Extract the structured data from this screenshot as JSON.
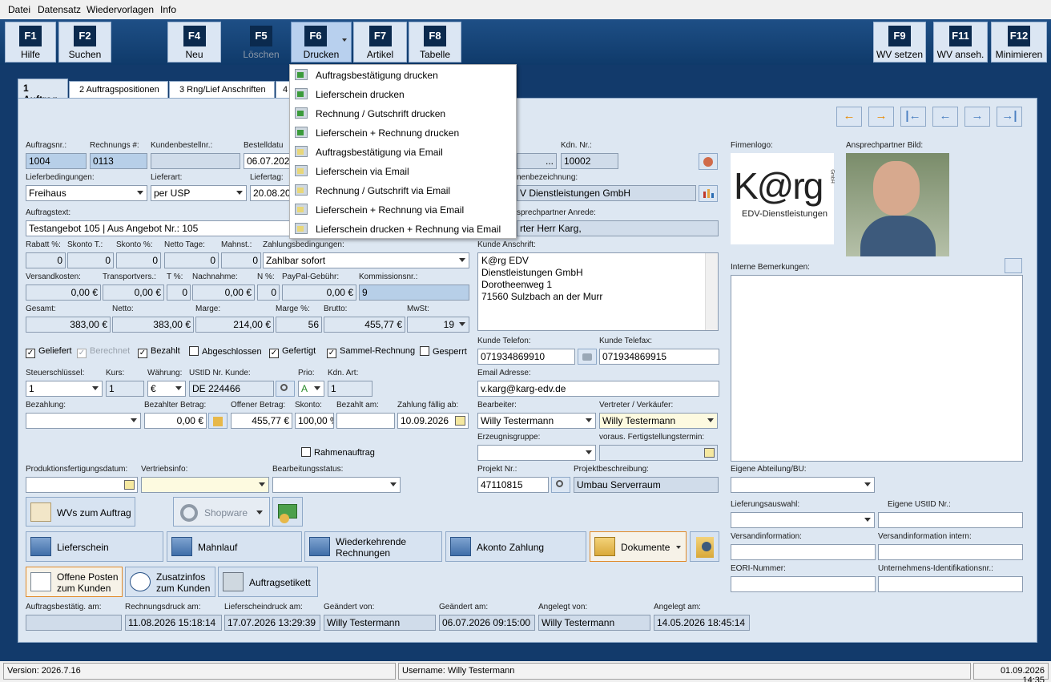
{
  "menu": [
    "Datei",
    "Datensatz",
    "Wiedervorlagen",
    "Info"
  ],
  "fkeys": [
    {
      "key": "F1",
      "label": "Hilfe"
    },
    {
      "key": "F2",
      "label": "Suchen"
    },
    {
      "key": "F4",
      "label": "Neu"
    },
    {
      "key": "F5",
      "label": "Löschen"
    },
    {
      "key": "F6",
      "label": "Drucken"
    },
    {
      "key": "F7",
      "label": "Artikel"
    },
    {
      "key": "F8",
      "label": "Tabelle"
    },
    {
      "key": "F9",
      "label": "WV setzen"
    },
    {
      "key": "F11",
      "label": "WV anseh."
    },
    {
      "key": "F12",
      "label": "Minimieren"
    }
  ],
  "tabs": [
    "1 Auftrag",
    "2 Auftragspositionen",
    "3 Rng/Lief Anschriften",
    "4"
  ],
  "dropdown": [
    "Auftragsbestätigung drucken",
    "Lieferschein drucken",
    "Rechnung / Gutschrift drucken",
    "Lieferschein + Rechnung drucken",
    "Auftragsbestätigung via Email",
    "Lieferschein via Email",
    "Rechnung / Gutschrift via Email",
    "Lieferschein + Rechnung via Email",
    "Lieferschein drucken + Rechnung via Email"
  ],
  "labels": {
    "auftragsnr": "Auftragsnr.:",
    "rechnungsnr": "Rechnungs #:",
    "kundenbestellnr": "Kundenbestellnr.:",
    "bestelldatum": "Bestelldatu",
    "kdnnr": "Kdn. Nr.:",
    "lieferbedingungen": "Lieferbedingungen:",
    "lieferart": "Lieferart:",
    "liefertag": "Liefertag:",
    "firmenbez": "nenbezeichnung:",
    "auftragstext": "Auftragstext:",
    "anrede": "sprechpartner Anrede:",
    "rabatt": "Rabatt %:",
    "skontoT": "Skonto T.:",
    "skontoP": "Skonto %:",
    "nettotage": "Netto Tage:",
    "mahnst": "Mahnst.:",
    "zahlungsbed": "Zahlungsbedingungen:",
    "kundeanschrift": "Kunde Anschrift:",
    "versandkosten": "Versandkosten:",
    "transportvers": "Transportvers.:",
    "tproz": "T %:",
    "nachnahme": "Nachnahme:",
    "nproz": "N %:",
    "paypal": "PayPal-Gebühr:",
    "kommission": "Kommissionsnr.:",
    "gesamt": "Gesamt:",
    "netto": "Netto:",
    "marge": "Marge:",
    "margeP": "Marge %:",
    "brutto": "Brutto:",
    "mwst": "MwSt:",
    "telefon": "Kunde Telefon:",
    "telefax": "Kunde Telefax:",
    "steuer": "Steuerschlüssel:",
    "kurs": "Kurs:",
    "waehrung": "Währung:",
    "ustid": "UStID Nr. Kunde:",
    "prio": "Prio:",
    "kdnart": "Kdn. Art:",
    "email": "Email Adresse:",
    "bezahlung": "Bezahlung:",
    "bezahlterbetrag": "Bezahlter Betrag:",
    "offenerbetrag": "Offener Betrag:",
    "skonto": "Skonto:",
    "bezahltam": "Bezahlt am:",
    "faellig": "Zahlung fällig ab:",
    "bearbeiter": "Bearbeiter:",
    "vertreter": "Vertreter / Verkäufer:",
    "erzeugnis": "Erzeugnisgruppe:",
    "voraus": "voraus. Fertigstellungstermin:",
    "prodfert": "Produktionsfertigungsdatum:",
    "vertrieb": "Vertriebsinfo:",
    "bearbstatus": "Bearbeitungsstatus:",
    "projektnr": "Projekt Nr.:",
    "projektbeschr": "Projektbeschreibung:",
    "firmenlogo": "Firmenlogo:",
    "ansprechbild": "Ansprechpartner Bild:",
    "interne": "Interne Bemerkungen:",
    "abteilung": "Eigene Abteilung/BU:",
    "lieferauswahl": "Lieferungsauswahl:",
    "eigeneustid": "Eigene UStID Nr.:",
    "versandinfo": "Versandinformation:",
    "versandintern": "Versandinformation intern:",
    "eori": "EORI-Nummer:",
    "unternehmensid": "Unternehmens-Identifikationsnr.:",
    "abdate": "Auftragsbestätig. am:",
    "rechdruck": "Rechnungsdruck am:",
    "liefdruck": "Lieferscheindruck am:",
    "geaendertvon": "Geändert von:",
    "geaendertam": "Geändert am:",
    "angelegtvon": "Angelegt von:",
    "angelegtam": "Angelegt am:"
  },
  "values": {
    "auftragsnr": "1004",
    "rechnungsnr": "0113",
    "kundenbestellnr": "",
    "bestelldatum": "06.07.202",
    "kdnnr": "10002",
    "kdnbtn": "...",
    "lieferbedingungen": "Freihaus",
    "lieferart": "per USP",
    "liefertag": "20.08.20",
    "firmenbez": "V Dienstleistungen GmbH",
    "auftragstext": "Testangebot 105 | Aus Angebot Nr.: 105",
    "anrede": "rter Herr Karg,",
    "rabatt": "0",
    "skontoT": "0",
    "skontoP": "0",
    "nettotage": "0",
    "mahnst": "0",
    "zahlungsbed": "Zahlbar sofort",
    "versandkosten": "0,00 €",
    "transportvers": "0,00 €",
    "tproz": "0",
    "nachnahme": "0,00 €",
    "nproz": "0",
    "paypal": "0,00 €",
    "kommission": "9",
    "gesamt": "383,00 €",
    "netto": "383,00 €",
    "marge": "214,00 €",
    "margeP": "56",
    "brutto": "455,77 €",
    "mwst": "19",
    "anschrift": [
      "K@rg EDV",
      "Dienstleistungen GmbH",
      "Dorotheenweg 1",
      "71560 Sulzbach an der Murr"
    ],
    "telefon": "071934869910",
    "telefax": "071934869915",
    "steuer": "1",
    "kurs": "1",
    "waehrung": "€",
    "ustid": "DE 224466",
    "prio": "A",
    "kdnart": "1",
    "email": "v.karg@karg-edv.de",
    "bezahlung": "",
    "bezahlterbetrag": "0,00 €",
    "offenerbetrag": "455,77 €",
    "skonto": "100,00 %",
    "bezahltam": "",
    "faellig": "10.09.2026",
    "bearbeiter": "Willy Testermann",
    "vertreter": "Willy Testermann",
    "projektnr": "47110815",
    "projektbeschr": "Umbau Serverraum",
    "abdate": "",
    "rechdruck": "11.08.2026 15:18:14",
    "liefdruck": "17.07.2026 13:29:39",
    "geaendertvon": "Willy Testermann",
    "geaendertam": "06.07.2026 09:15:00",
    "angelegtvon": "Willy Testermann",
    "angelegtam": "14.05.2026 18:45:14"
  },
  "checks": {
    "geliefert": {
      "label": "Geliefert",
      "checked": true
    },
    "berechnet": {
      "label": "Berechnet",
      "checked": true
    },
    "bezahlt": {
      "label": "Bezahlt",
      "checked": true
    },
    "abgeschlossen": {
      "label": "Abgeschlossen",
      "checked": false
    },
    "gefertigt": {
      "label": "Gefertigt",
      "checked": true
    },
    "sammel": {
      "label": "Sammel-Rechnung",
      "checked": true
    },
    "gesperrt": {
      "label": "Gesperrt",
      "checked": false
    },
    "rahmen": {
      "label": "Rahmenauftrag",
      "checked": false
    }
  },
  "buttons": {
    "wvs": "WVs zum Auftrag",
    "shopware": "Shopware",
    "lieferschein": "Lieferschein",
    "mahnlauf": "Mahnlauf",
    "wiederkehrend1": "Wiederkehrende",
    "wiederkehrend2": "Rechnungen",
    "akonto": "Akonto Zahlung",
    "dokumente": "Dokumente",
    "offene1": "Offene Posten",
    "offene2": "zum Kunden",
    "zusatz1": "Zusatzinfos",
    "zusatz2": "zum Kunden",
    "etikett": "Auftragsetikett"
  },
  "logo": {
    "brand": "K@rg",
    "sub": "EDV-Dienstleistungen",
    "gmbh": "GmbH"
  },
  "status": {
    "version": "Version: 2026.7.16",
    "user": "Username: Willy Testermann",
    "datetime": "01.09.2026 14:35"
  }
}
